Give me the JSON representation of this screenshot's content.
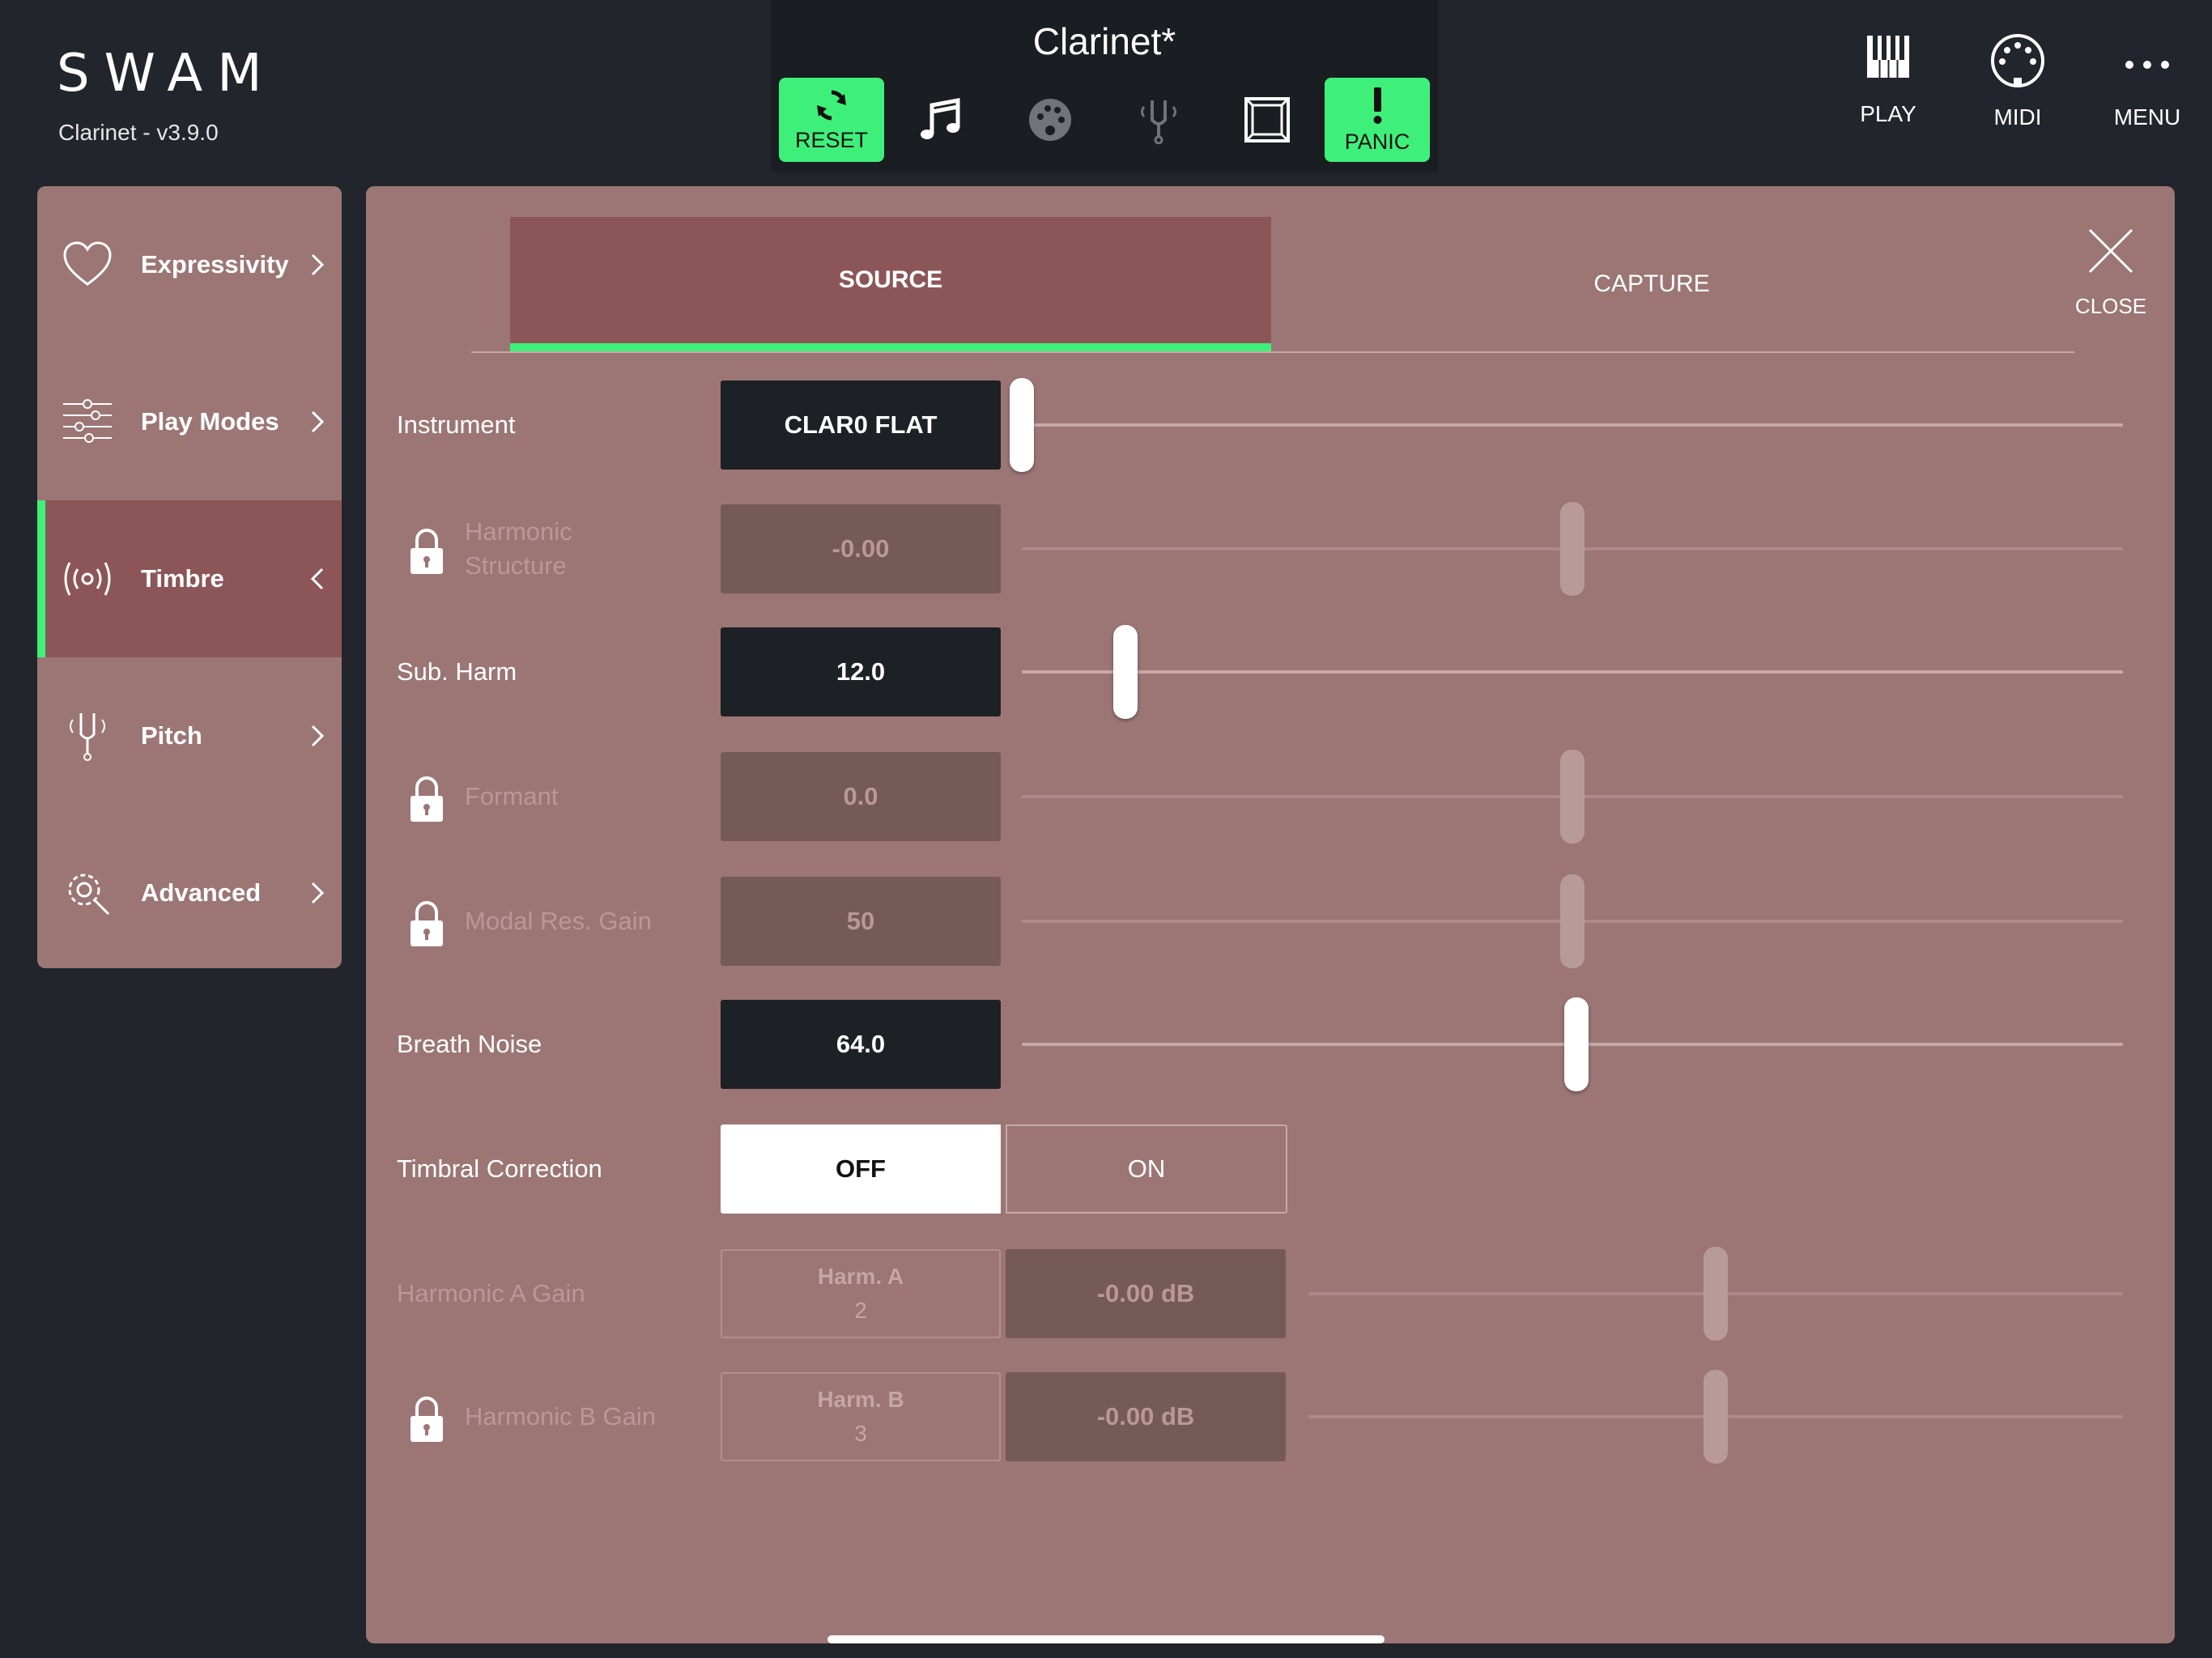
{
  "header": {
    "logo": "SWAM",
    "version": "Clarinet - v3.9.0",
    "preset_name": "Clarinet*",
    "reset_label": "RESET",
    "panic_label": "PANIC",
    "play_label": "PLAY",
    "midi_label": "MIDI",
    "menu_label": "MENU"
  },
  "sidebar": {
    "items": [
      {
        "label": "Expressivity",
        "icon": "heart-icon"
      },
      {
        "label": "Play Modes",
        "icon": "sliders-icon"
      },
      {
        "label": "Timbre",
        "icon": "broadcast-icon",
        "active": true
      },
      {
        "label": "Pitch",
        "icon": "tuning-fork-icon"
      },
      {
        "label": "Advanced",
        "icon": "gear-icon"
      }
    ]
  },
  "tabs": {
    "source": "SOURCE",
    "capture": "CAPTURE",
    "close": "CLOSE"
  },
  "params": {
    "instrument": {
      "label": "Instrument",
      "value": "CLAR0 FLAT",
      "slider": 0.0
    },
    "harmonic_structure": {
      "label": "Harmonic Structure",
      "value": "-0.00",
      "locked": true,
      "slider": 0.5
    },
    "sub_harm": {
      "label": "Sub. Harm",
      "value": "12.0",
      "slider": 0.094
    },
    "formant": {
      "label": "Formant",
      "value": "0.0",
      "locked": true,
      "slider": 0.5
    },
    "modal_res_gain": {
      "label": "Modal Res. Gain",
      "value": "50",
      "locked": true,
      "slider": 0.5
    },
    "breath_noise": {
      "label": "Breath Noise",
      "value": "64.0",
      "slider": 0.504
    },
    "timbral_correction": {
      "label": "Timbral Correction",
      "off": "OFF",
      "on": "ON",
      "selected": "OFF"
    },
    "harmonic_a_gain": {
      "label": "Harmonic A Gain",
      "harm_label": "Harm. A",
      "harm_value": "2",
      "value": "-0.00 dB",
      "slider": 0.5
    },
    "harmonic_b_gain": {
      "label": "Harmonic B Gain",
      "harm_label": "Harm. B",
      "harm_value": "3",
      "value": "-0.00 dB",
      "locked": true,
      "slider": 0.5
    }
  },
  "colors": {
    "accent_green": "#3ef07a",
    "panel": "#9b7675",
    "active": "#8c5659",
    "background": "#22252b"
  }
}
